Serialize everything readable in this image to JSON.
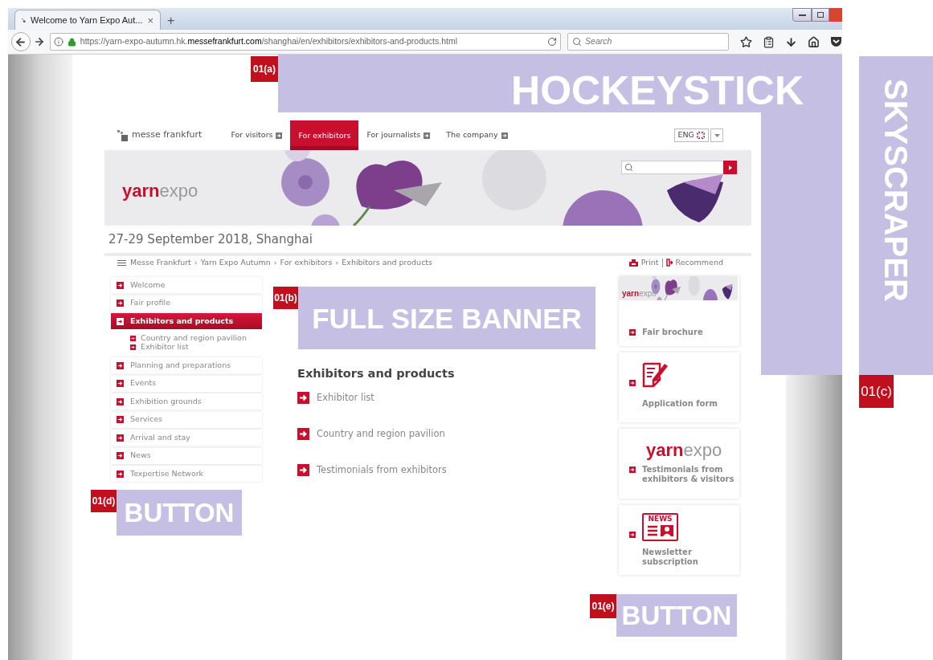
{
  "browser": {
    "tab": {
      "title": "Welcome to Yarn Expo Aut...",
      "close": "×"
    },
    "new_tab": "+",
    "url": "https://yarn-expo-autumn.hk.**messefrankfurt.com**/shanghai/en/exhibitors/exhibitors-and-products.html",
    "search": {
      "placeholder": "Search"
    }
  },
  "site": {
    "logo": "messe frankfurt",
    "nav": [
      {
        "label": "For visitors",
        "selected": false
      },
      {
        "label": "For exhibitors",
        "selected": true
      },
      {
        "label": "For journalists",
        "selected": false
      },
      {
        "label": "The company",
        "selected": false
      }
    ],
    "language": "ENG",
    "brand": {
      "bold": "yarn",
      "light": "expo"
    },
    "date": "27-29 September 2018, Shanghai",
    "breadcrumb": [
      "Messe Frankfurt",
      "Yarn Expo Autumn",
      "For exhibitors",
      "Exhibitors and products"
    ],
    "breadcrumb_separator": "›",
    "actions": [
      {
        "kind": "print",
        "label": "Print"
      },
      {
        "kind": "recommend",
        "label": "Recommend"
      }
    ],
    "sidebar": [
      {
        "label": "Welcome",
        "selected": false
      },
      {
        "label": "Fair profile",
        "selected": false
      },
      {
        "label": "Exhibitors and products",
        "selected": true,
        "children": [
          {
            "label": "Country and region pavilion"
          },
          {
            "label": "Exhibitor list"
          }
        ]
      },
      {
        "label": "Planning and preparations",
        "selected": false
      },
      {
        "label": "Events",
        "selected": false
      },
      {
        "label": "Exhibition grounds",
        "selected": false
      },
      {
        "label": "Services",
        "selected": false
      },
      {
        "label": "Arrival and stay",
        "selected": false
      },
      {
        "label": "News",
        "selected": false
      },
      {
        "label": "Texpertise Network",
        "selected": false
      }
    ],
    "content": {
      "heading": "Exhibitors and products",
      "links": [
        "Exhibitor list",
        "Country and region pavilion",
        "Testimonials from exhibitors"
      ]
    },
    "cards": [
      {
        "kind": "brochure",
        "brand": {
          "bold": "yarn",
          "light": "expo"
        },
        "label": "Fair brochure"
      },
      {
        "kind": "form",
        "label": "Application form"
      },
      {
        "kind": "logo",
        "brand": {
          "bold": "yarn",
          "light": "expo"
        },
        "label": "Testimonials from exhibitors & visitors"
      },
      {
        "kind": "news",
        "icon_text": "NEWS",
        "label": "Newsletter subscription"
      }
    ]
  },
  "placements": [
    {
      "kind": "hockeystick",
      "label": "01(a)",
      "text": "HOCKEYSTICK"
    },
    {
      "kind": "banner",
      "label": "01(b)",
      "text": "FULL SIZE BANNER"
    },
    {
      "kind": "skyscraper",
      "label": "01(c)",
      "text": "SKYSCRAPER"
    },
    {
      "kind": "button",
      "label": "01(d)",
      "text": "BUTTON"
    },
    {
      "kind": "button",
      "label": "01(e)",
      "text": "BUTTON"
    }
  ]
}
